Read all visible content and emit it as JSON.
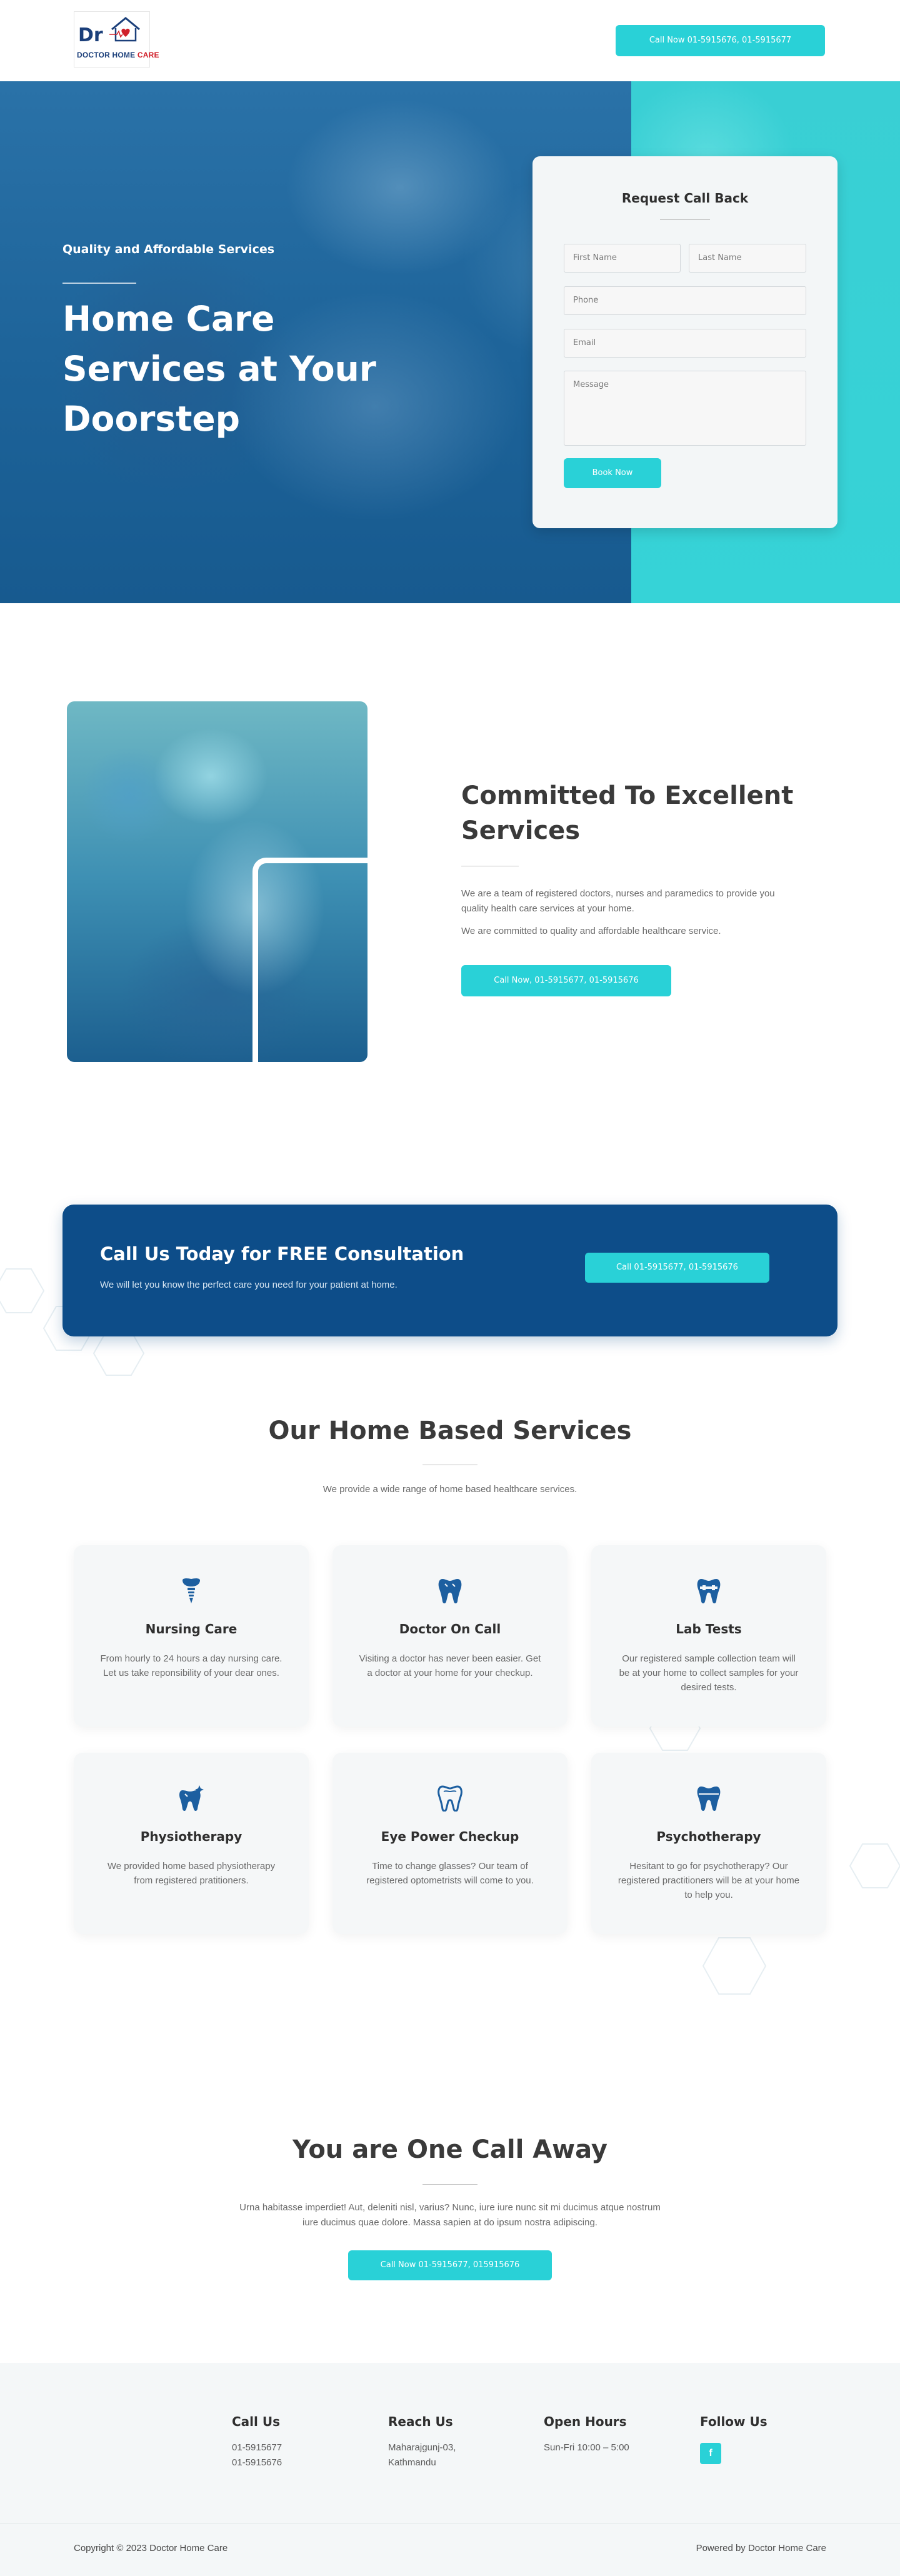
{
  "header": {
    "logo": {
      "dr": "Dr",
      "brand_main": "DOCTOR HOME",
      "brand_accent": "CARE"
    },
    "cta_label": "Call Now 01-5915676, 01-5915677"
  },
  "hero": {
    "subtitle": "Quality and Affordable Services",
    "title": "Home Care Services at Your Doorstep"
  },
  "callback_form": {
    "title": "Request Call Back",
    "first_name_placeholder": "First Name",
    "last_name_placeholder": "Last Name",
    "phone_placeholder": "Phone",
    "email_placeholder": "Email",
    "message_placeholder": "Message",
    "submit_label": "Book Now"
  },
  "about": {
    "title": "Committed To Excellent Services",
    "paragraph1": "We are a team of registered doctors, nurses and paramedics to provide you quality health care services at your home.",
    "paragraph2": "We are committed to quality and affordable healthcare service.",
    "cta_label": "Call Now, 01-5915677, 01-5915676"
  },
  "consultation": {
    "title": "Call Us Today for FREE Consultation",
    "subtitle": "We will let you know the perfect care you need for your patient at home.",
    "cta_label": "Call 01-5915677, 01-5915676"
  },
  "services": {
    "title": "Our Home Based Services",
    "subtitle": "We provide a wide range of home based healthcare services.",
    "items": [
      {
        "icon": "tooth-implant-icon",
        "title": "Nursing Care",
        "description": "From hourly to 24 hours a day nursing care. Let us take reponsibility of your dear ones."
      },
      {
        "icon": "tooth-icon",
        "title": "Doctor On Call",
        "description": "Visiting a doctor has never been easier. Get a doctor at your home for your checkup."
      },
      {
        "icon": "tooth-braces-icon",
        "title": "Lab Tests",
        "description": "Our registered sample collection team will be at your home to collect samples for your desired tests."
      },
      {
        "icon": "tooth-sparkle-icon",
        "title": "Physiotherapy",
        "description": "We provided home based physiotherapy from registered pratitioners."
      },
      {
        "icon": "tooth-icon",
        "title": "Eye Power Checkup",
        "description": "Time to change glasses? Our team of registered optometrists will come to you."
      },
      {
        "icon": "tooth-icon",
        "title": "Psychotherapy",
        "description": "Hesitant to go for psychotherapy? Our registered practitioners will be at your home to help you."
      }
    ],
    "icon_color": "#1d5fa0"
  },
  "call_away": {
    "title": "You are One Call Away",
    "text": "Urna habitasse imperdiet! Aut, deleniti nisl, varius? Nunc, iure iure nunc sit mi ducimus atque nostrum iure ducimus quae dolore. Massa sapien at do ipsum nostra adipiscing.",
    "cta_label": "Call Now 01-5915677, 015915676"
  },
  "footer": {
    "call_us": {
      "heading": "Call Us",
      "line1": "01-5915677",
      "line2": "01-5915676"
    },
    "reach_us": {
      "heading": "Reach Us",
      "line1": "Maharajgunj-03,",
      "line2": "Kathmandu"
    },
    "open_hours": {
      "heading": "Open Hours",
      "line1": "Sun-Fri 10:00 – 5:00"
    },
    "follow_us": {
      "heading": "Follow Us",
      "facebook_glyph": "f"
    },
    "copyright": "Copyright © 2023 Doctor Home Care",
    "powered_by": "Powered by Doctor Home Care"
  },
  "colors": {
    "accent": "#29d1d7",
    "primary_dark": "#0d4d89",
    "hero_blue": "#19679e"
  }
}
